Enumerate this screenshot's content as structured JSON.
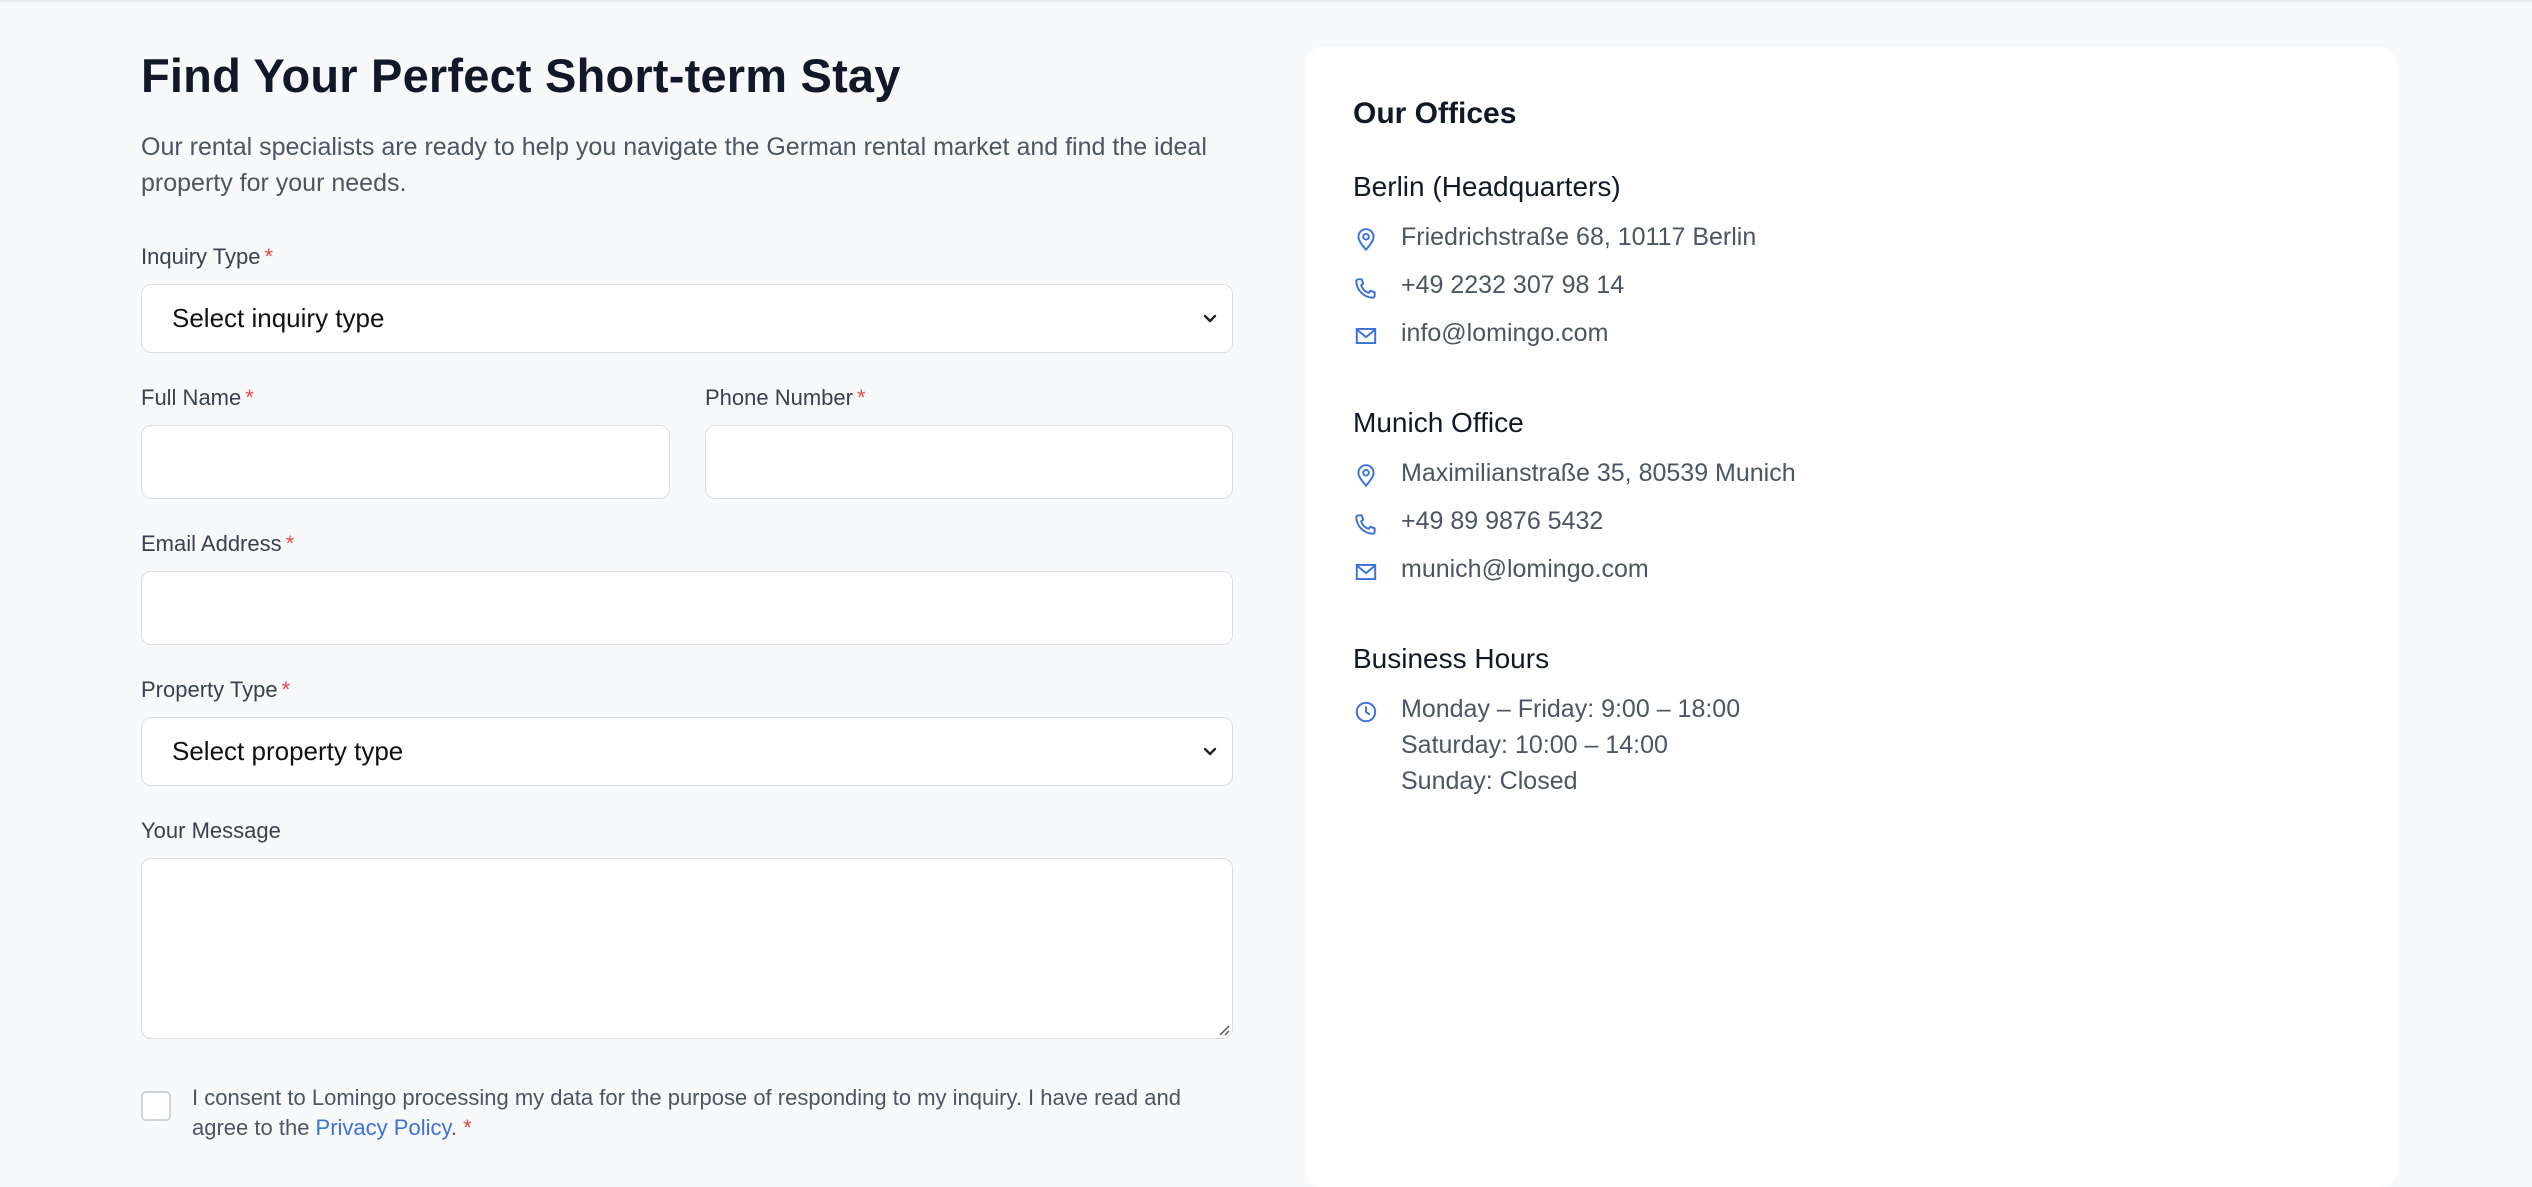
{
  "form": {
    "title": "Find Your Perfect Short-term Stay",
    "subtitle": "Our rental specialists are ready to help you navigate the German rental market and find the ideal property for your needs.",
    "inquiry_type": {
      "label": "Inquiry Type",
      "required": "*",
      "value": "Select inquiry type"
    },
    "full_name": {
      "label": "Full Name",
      "required": "*",
      "value": ""
    },
    "phone": {
      "label": "Phone Number",
      "required": "*",
      "value": ""
    },
    "email": {
      "label": "Email Address",
      "required": "*",
      "value": ""
    },
    "property_type": {
      "label": "Property Type",
      "required": "*",
      "value": "Select property type"
    },
    "message": {
      "label": "Your Message",
      "value": ""
    },
    "consent": {
      "text_before": "I consent to Lomingo processing my data for the purpose of responding to my inquiry. I have read and agree to the ",
      "link_text": "Privacy Policy",
      "text_after": ".",
      "required": "*"
    }
  },
  "offices": {
    "heading": "Our Offices",
    "berlin": {
      "title": "Berlin (Headquarters)",
      "address": "Friedrichstraße 68, 10117 Berlin",
      "phone": "+49 2232 307 98 14",
      "email": "info@lomingo.com"
    },
    "munich": {
      "title": "Munich Office",
      "address": "Maximilianstraße 35, 80539 Munich",
      "phone": "+49 89 9876 5432",
      "email": "munich@lomingo.com"
    },
    "hours": {
      "title": "Business Hours",
      "weekdays": "Monday – Friday: 9:00 – 18:00",
      "saturday": "Saturday: 10:00 – 14:00",
      "sunday": "Sunday: Closed"
    }
  },
  "colors": {
    "accent": "#3b72d6",
    "required": "#e24a4a",
    "background": "#f8f9fb"
  }
}
